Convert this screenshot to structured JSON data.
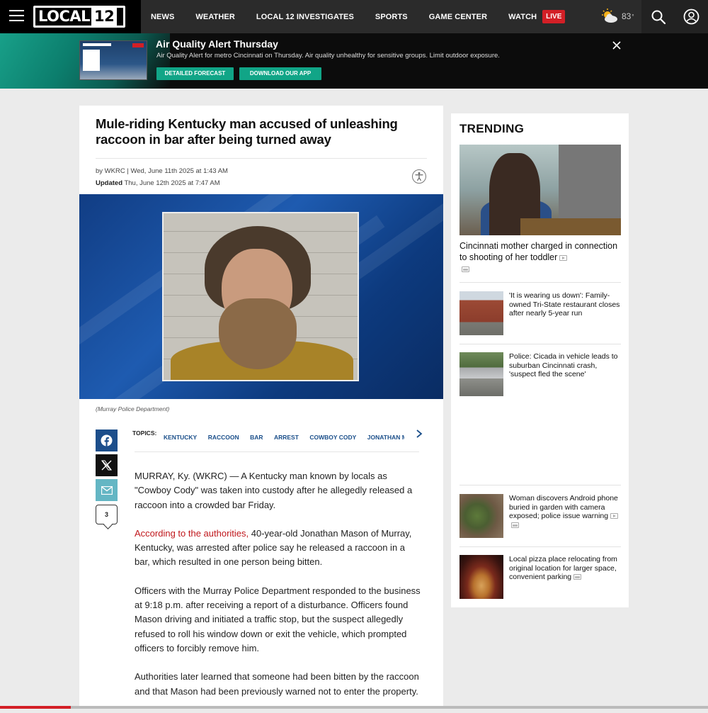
{
  "nav": {
    "logo_text": "LOCAL",
    "logo_num": "12",
    "links": [
      "NEWS",
      "WEATHER",
      "LOCAL 12 INVESTIGATES",
      "SPORTS",
      "GAME CENTER",
      "WATCH"
    ],
    "live": "LIVE",
    "temperature": "83",
    "degree": "°"
  },
  "alert": {
    "title": "Air Quality Alert Thursday",
    "text": "Air Quality Alert for metro Cincinnati on Thursday. Air quality unhealthy for sensitive groups. Limit outdoor exposure.",
    "btn_forecast": "DETAILED FORECAST",
    "btn_app": "DOWNLOAD OUR APP"
  },
  "article": {
    "headline": "Mule-riding Kentucky man accused of unleashing raccoon in bar after being turned away",
    "byline": "by WKRC | Wed, June 11th 2025 at 1:43 AM",
    "updated_label": "Updated",
    "updated_date": "Thu, June 12th 2025 at 7:47 AM",
    "caption": "(Murray Police Department)",
    "comment_count": "3",
    "topics_label": "TOPICS:",
    "topics": [
      "KENTUCKY",
      "RACCOON",
      "BAR",
      "ARREST",
      "COWBOY CODY",
      "JONATHAN MASON"
    ],
    "p1": "MURRAY, Ky. (WKRC) — A Kentucky man known by locals as \"Cowboy Cody\" was taken into custody after he allegedly released a raccoon into a crowded bar Friday.",
    "p2_link": "According to the authorities,",
    "p2_rest": " 40-year-old Jonathan Mason of Murray, Kentucky, was arrested after police say he released a raccoon in a bar, which resulted in one person being bitten.",
    "p3": "Officers with the Murray Police Department responded to the business at 9:18 p.m. after receiving a report of a disturbance. Officers found Mason driving and initiated a traffic stop, but the suspect allegedly refused to roll his window down or exit the vehicle, which prompted officers to forcibly remove him.",
    "p4": "Authorities later learned that someone had been bitten by the raccoon and that Mason had been previously warned not to enter the property."
  },
  "trending": {
    "title": "TRENDING",
    "hero_title": "Cincinnati mother charged in connection to shooting of her toddler",
    "items": [
      {
        "title": "'It is wearing us down': Family-owned Tri-State restaurant closes after nearly 5-year run"
      },
      {
        "title": "Police: Cicada in vehicle leads to suburban Cincinnati crash, 'suspect fled the scene'"
      },
      {
        "title": "Woman discovers Android phone buried in garden with camera exposed; police issue warning"
      },
      {
        "title": "Local pizza place relocating from original location for larger space, convenient parking"
      }
    ]
  },
  "reading_progress": 0.1,
  "colors": {
    "accent_red": "#d31f26",
    "alert_green": "#11a587",
    "topic_blue": "#1b4f8a",
    "link_red": "#c0171c"
  }
}
